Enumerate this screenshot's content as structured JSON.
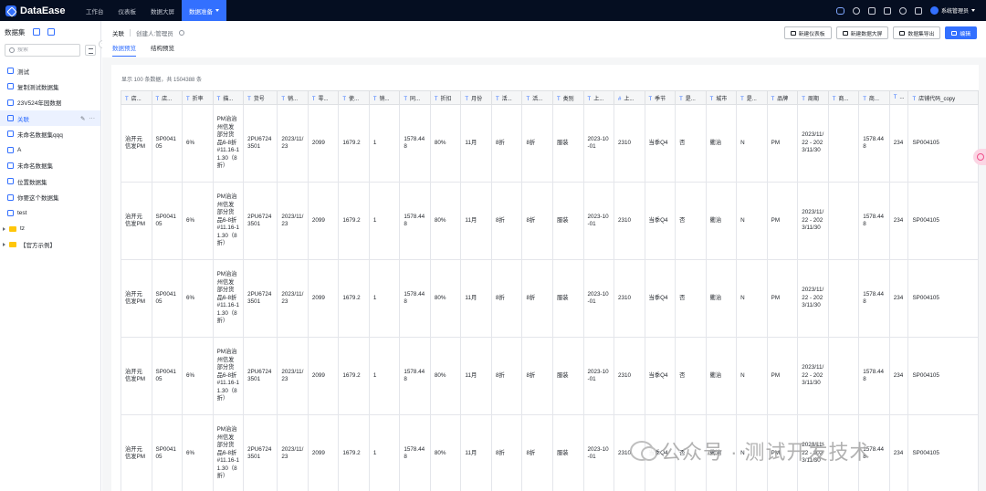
{
  "app": {
    "name": "DataEase"
  },
  "nav": {
    "items": [
      "工作台",
      "仪表板",
      "数据大屏"
    ],
    "active": "数据准备"
  },
  "user": {
    "name": "系统管理员"
  },
  "sidebar": {
    "title": "数据集",
    "search_placeholder": "搜索",
    "items": [
      {
        "label": "测试",
        "kind": "dataset"
      },
      {
        "label": "复制测试数据集",
        "kind": "dataset"
      },
      {
        "label": "23V524年园数据",
        "kind": "dataset"
      },
      {
        "label": "关联",
        "kind": "dataset",
        "selected": true
      },
      {
        "label": "未命名数据集qqq",
        "kind": "dataset"
      },
      {
        "label": "A",
        "kind": "dataset"
      },
      {
        "label": "未命名数据集",
        "kind": "dataset"
      },
      {
        "label": "位置数据集",
        "kind": "dataset"
      },
      {
        "label": "你要这个数据集",
        "kind": "dataset"
      },
      {
        "label": "test",
        "kind": "dataset"
      },
      {
        "label": "tz",
        "kind": "folder"
      },
      {
        "label": "【官方示例】",
        "kind": "folder"
      }
    ]
  },
  "header": {
    "title": "关联",
    "creator": "创建人:管理员",
    "tabs": [
      "数据预览",
      "结构预览"
    ],
    "buttons": [
      "新建仪表板",
      "新建数据大屏",
      "数据集导出",
      "编辑"
    ]
  },
  "table": {
    "summary": "显示 100 条数据，共 1504388 条",
    "columns": [
      {
        "type": "T",
        "name": "店..."
      },
      {
        "type": "T",
        "name": "店..."
      },
      {
        "type": "T",
        "name": "折率"
      },
      {
        "type": "T",
        "name": "描..."
      },
      {
        "type": "T",
        "name": "货号"
      },
      {
        "type": "T",
        "name": "销..."
      },
      {
        "type": "T",
        "name": "零..."
      },
      {
        "type": "T",
        "name": "使..."
      },
      {
        "type": "T",
        "name": "销..."
      },
      {
        "type": "T",
        "name": "同..."
      },
      {
        "type": "T",
        "name": "折扣"
      },
      {
        "type": "T",
        "name": "月份"
      },
      {
        "type": "T",
        "name": "活..."
      },
      {
        "type": "T",
        "name": "活..."
      },
      {
        "type": "T",
        "name": "类别"
      },
      {
        "type": "T",
        "name": "上..."
      },
      {
        "type": "#",
        "name": "上..."
      },
      {
        "type": "T",
        "name": "季节"
      },
      {
        "type": "T",
        "name": "是..."
      },
      {
        "type": "T",
        "name": "城市"
      },
      {
        "type": "T",
        "name": "是..."
      },
      {
        "type": "T",
        "name": "品牌"
      },
      {
        "type": "T",
        "name": "周期"
      },
      {
        "type": "T",
        "name": "商..."
      },
      {
        "type": "T",
        "name": "商..."
      },
      {
        "type": "T",
        "name": "..."
      },
      {
        "type": "T",
        "name": "店铺代码_copy"
      }
    ],
    "rows": [
      [
        "治开元信发PM",
        "SP004105",
        "6%",
        "PM治治州信发部分货品6-8折#11.16-11.30（8折）",
        "2PU67243501",
        "2023/11/23",
        "2099",
        "1679.2",
        "1",
        "1578.448",
        "80%",
        "11月",
        "8折",
        "8折",
        "服装",
        "2023-10-01",
        "2310",
        "当季Q4",
        "否",
        "衢治",
        "N",
        "PM",
        "2023/11/22 - 2023/11/30",
        "",
        "1578.448",
        "234",
        "SP004105"
      ],
      [
        "治开元信发PM",
        "SP004105",
        "6%",
        "PM治治州信发部分货品6-8折#11.16-11.30（8折）",
        "2PU67243501",
        "2023/11/23",
        "2099",
        "1679.2",
        "1",
        "1578.448",
        "80%",
        "11月",
        "8折",
        "8折",
        "服装",
        "2023-10-01",
        "2310",
        "当季Q4",
        "否",
        "衢治",
        "N",
        "PM",
        "2023/11/22 - 2023/11/30",
        "",
        "1578.448",
        "234",
        "SP004105"
      ],
      [
        "治开元信发PM",
        "SP004105",
        "6%",
        "PM治治州信发部分货品6-8折#11.16-11.30（8折）",
        "2PU67243501",
        "2023/11/23",
        "2099",
        "1679.2",
        "1",
        "1578.448",
        "80%",
        "11月",
        "8折",
        "8折",
        "服装",
        "2023-10-01",
        "2310",
        "当季Q4",
        "否",
        "衢治",
        "N",
        "PM",
        "2023/11/22 - 2023/11/30",
        "",
        "1578.448",
        "234",
        "SP004105"
      ],
      [
        "治开元信发PM",
        "SP004105",
        "6%",
        "PM治治州信发部分货品6-8折#11.16-11.30（8折）",
        "2PU67243501",
        "2023/11/23",
        "2099",
        "1679.2",
        "1",
        "1578.448",
        "80%",
        "11月",
        "8折",
        "8折",
        "服装",
        "2023-10-01",
        "2310",
        "当季Q4",
        "否",
        "衢治",
        "N",
        "PM",
        "2023/11/22 - 2023/11/30",
        "",
        "1578.448",
        "234",
        "SP004105"
      ],
      [
        "治开元信发PM",
        "SP004105",
        "6%",
        "PM治治州信发部分货品6-8折#11.16-11.30（8折）",
        "2PU67243501",
        "2023/11/23",
        "2099",
        "1679.2",
        "1",
        "1578.448",
        "80%",
        "11月",
        "8折",
        "8折",
        "服装",
        "2023-10-01",
        "2310",
        "当季Q4",
        "否",
        "衢治",
        "N",
        "PM",
        "2023/11/22 - 2023/11/30",
        "",
        "1578.448",
        "234",
        "SP004105"
      ]
    ]
  },
  "watermark": "公众号 · 测试开发技术"
}
